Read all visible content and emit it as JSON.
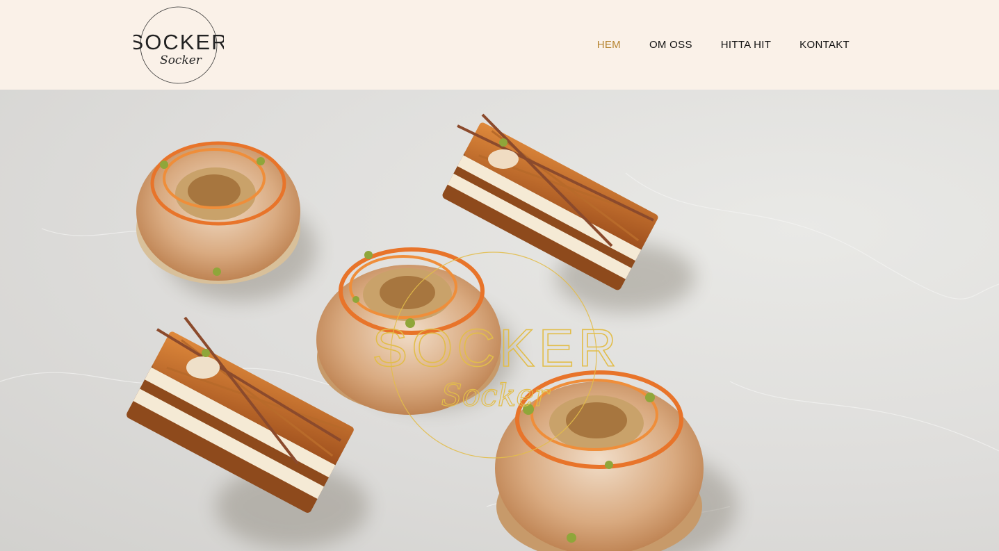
{
  "brand": {
    "name": "SOCKER",
    "script": "Socker",
    "logo_icon": "socker-logo-icon"
  },
  "nav": {
    "items": [
      {
        "label": "HEM",
        "active": true
      },
      {
        "label": "OM OSS",
        "active": false
      },
      {
        "label": "HITTA HIT",
        "active": false
      },
      {
        "label": "KONTAKT",
        "active": false
      }
    ]
  },
  "hero": {
    "watermark_name": "SOCKER",
    "watermark_script": "Socker"
  },
  "colors": {
    "header_bg": "#faf1e8",
    "accent_gold": "#b5832e",
    "watermark_gold": "#e2bd4a",
    "nav_text": "#111111"
  }
}
